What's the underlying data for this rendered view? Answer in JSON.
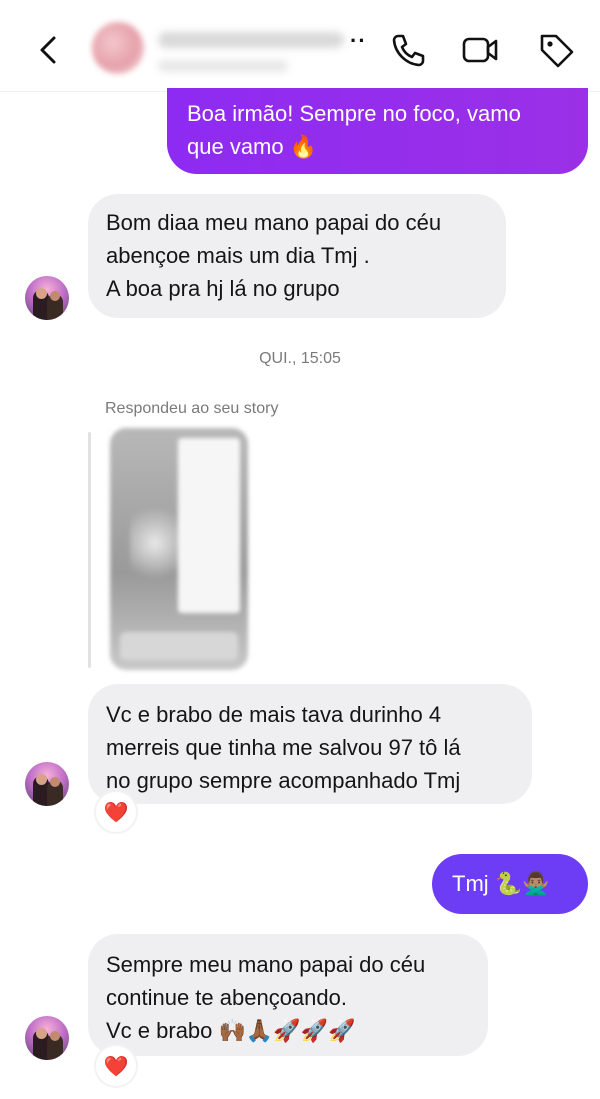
{
  "header": {
    "dots": "··",
    "icons": [
      "back-arrow-icon",
      "phone-icon",
      "video-camera-icon",
      "tag-icon"
    ]
  },
  "messages": [
    {
      "id": "m1",
      "direction": "outgoing",
      "lines": [
        "Boa irmão! Sempre no foco, vamo",
        "que vamo 🔥"
      ]
    },
    {
      "id": "m2",
      "direction": "incoming",
      "lines": [
        "Bom diaa meu mano papai do céu",
        "abençoe mais um dia Tmj .",
        "A boa pra hj lá no grupo"
      ]
    },
    {
      "id": "m3",
      "direction": "incoming",
      "lines": [
        "Vc e brabo de mais tava durinho 4",
        "merreis que tinha me salvou 97 tô lá",
        "no grupo sempre acompanhado Tmj"
      ],
      "reaction": "❤️"
    },
    {
      "id": "m4",
      "direction": "outgoing",
      "lines": [
        "Tmj 🐍🙅🏽‍♂️"
      ]
    },
    {
      "id": "m5",
      "direction": "incoming",
      "lines": [
        "Sempre meu mano papai do céu",
        "continue te abençoando.",
        "Vc e brabo 🙌🏾🙏🏾🚀🚀🚀"
      ],
      "reaction": "❤️"
    }
  ],
  "timestamp": "QUI., 15:05",
  "story_reply": {
    "label": "Respondeu ao seu story"
  },
  "colors": {
    "outgoing_bubble": "#8e2bf2",
    "outgoing_bubble_m4": "#6d3cf5",
    "incoming_bubble": "#efeff1",
    "meta_text": "#7a7a7a"
  }
}
